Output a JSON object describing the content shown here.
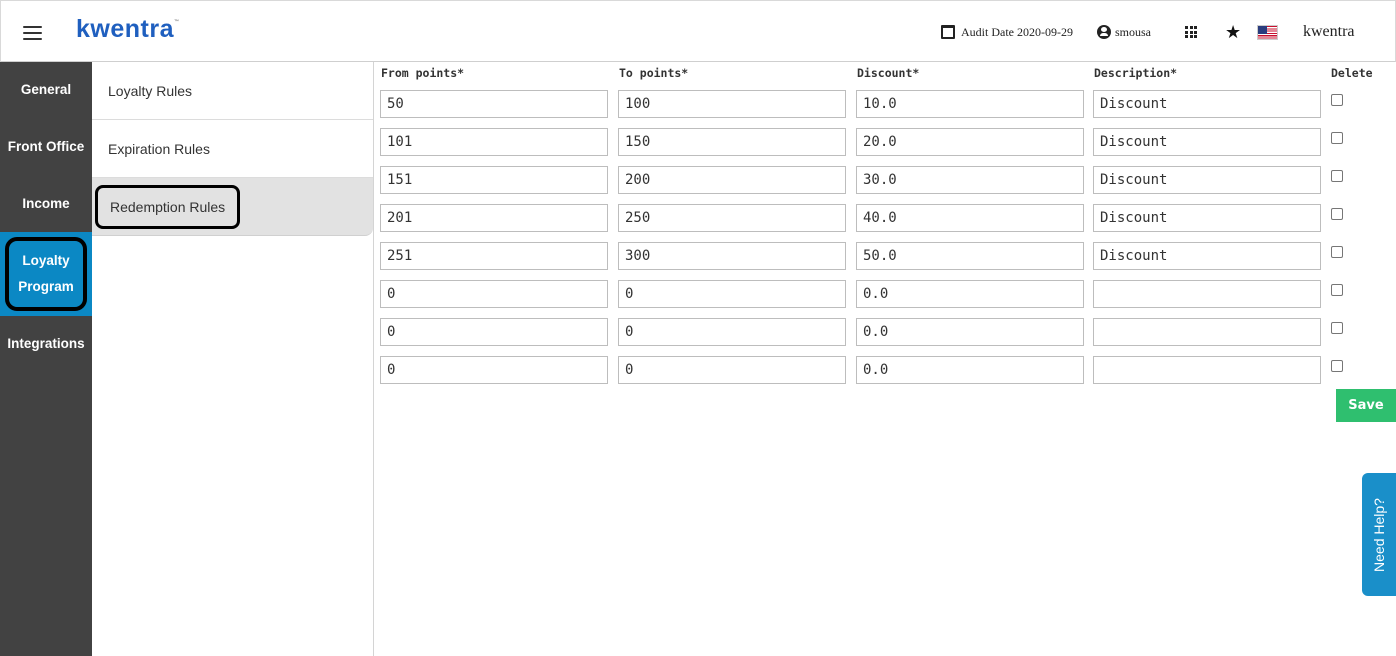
{
  "header": {
    "logo": "kwentra",
    "audit_date": "Audit Date 2020-09-29",
    "username": "smousa",
    "brand": "kwentra"
  },
  "leftnav": {
    "general": "General",
    "front_office": "Front Office",
    "income": "Income",
    "loyalty_line1": "Loyalty",
    "loyalty_line2": "Program",
    "integrations": "Integrations"
  },
  "subnav": {
    "loyalty_rules": "Loyalty Rules",
    "expiration_rules": "Expiration Rules",
    "redemption_rules": "Redemption Rules"
  },
  "table": {
    "headers": {
      "from": "From points*",
      "to": "To points*",
      "discount": "Discount*",
      "description": "Description*",
      "delete": "Delete"
    },
    "rows": [
      {
        "from": "50",
        "to": "100",
        "discount": "10.0",
        "description": "Discount"
      },
      {
        "from": "101",
        "to": "150",
        "discount": "20.0",
        "description": "Discount"
      },
      {
        "from": "151",
        "to": "200",
        "discount": "30.0",
        "description": "Discount"
      },
      {
        "from": "201",
        "to": "250",
        "discount": "40.0",
        "description": "Discount"
      },
      {
        "from": "251",
        "to": "300",
        "discount": "50.0",
        "description": "Discount"
      },
      {
        "from": "0",
        "to": "0",
        "discount": "0.0",
        "description": ""
      },
      {
        "from": "0",
        "to": "0",
        "discount": "0.0",
        "description": ""
      },
      {
        "from": "0",
        "to": "0",
        "discount": "0.0",
        "description": ""
      }
    ]
  },
  "actions": {
    "save": "Save",
    "help": "Need Help?"
  },
  "colors": {
    "accent_blue": "#0b88c4",
    "nav_dark": "#424242",
    "save_green": "#2fbf6f",
    "logo_blue": "#1f5fbf"
  }
}
